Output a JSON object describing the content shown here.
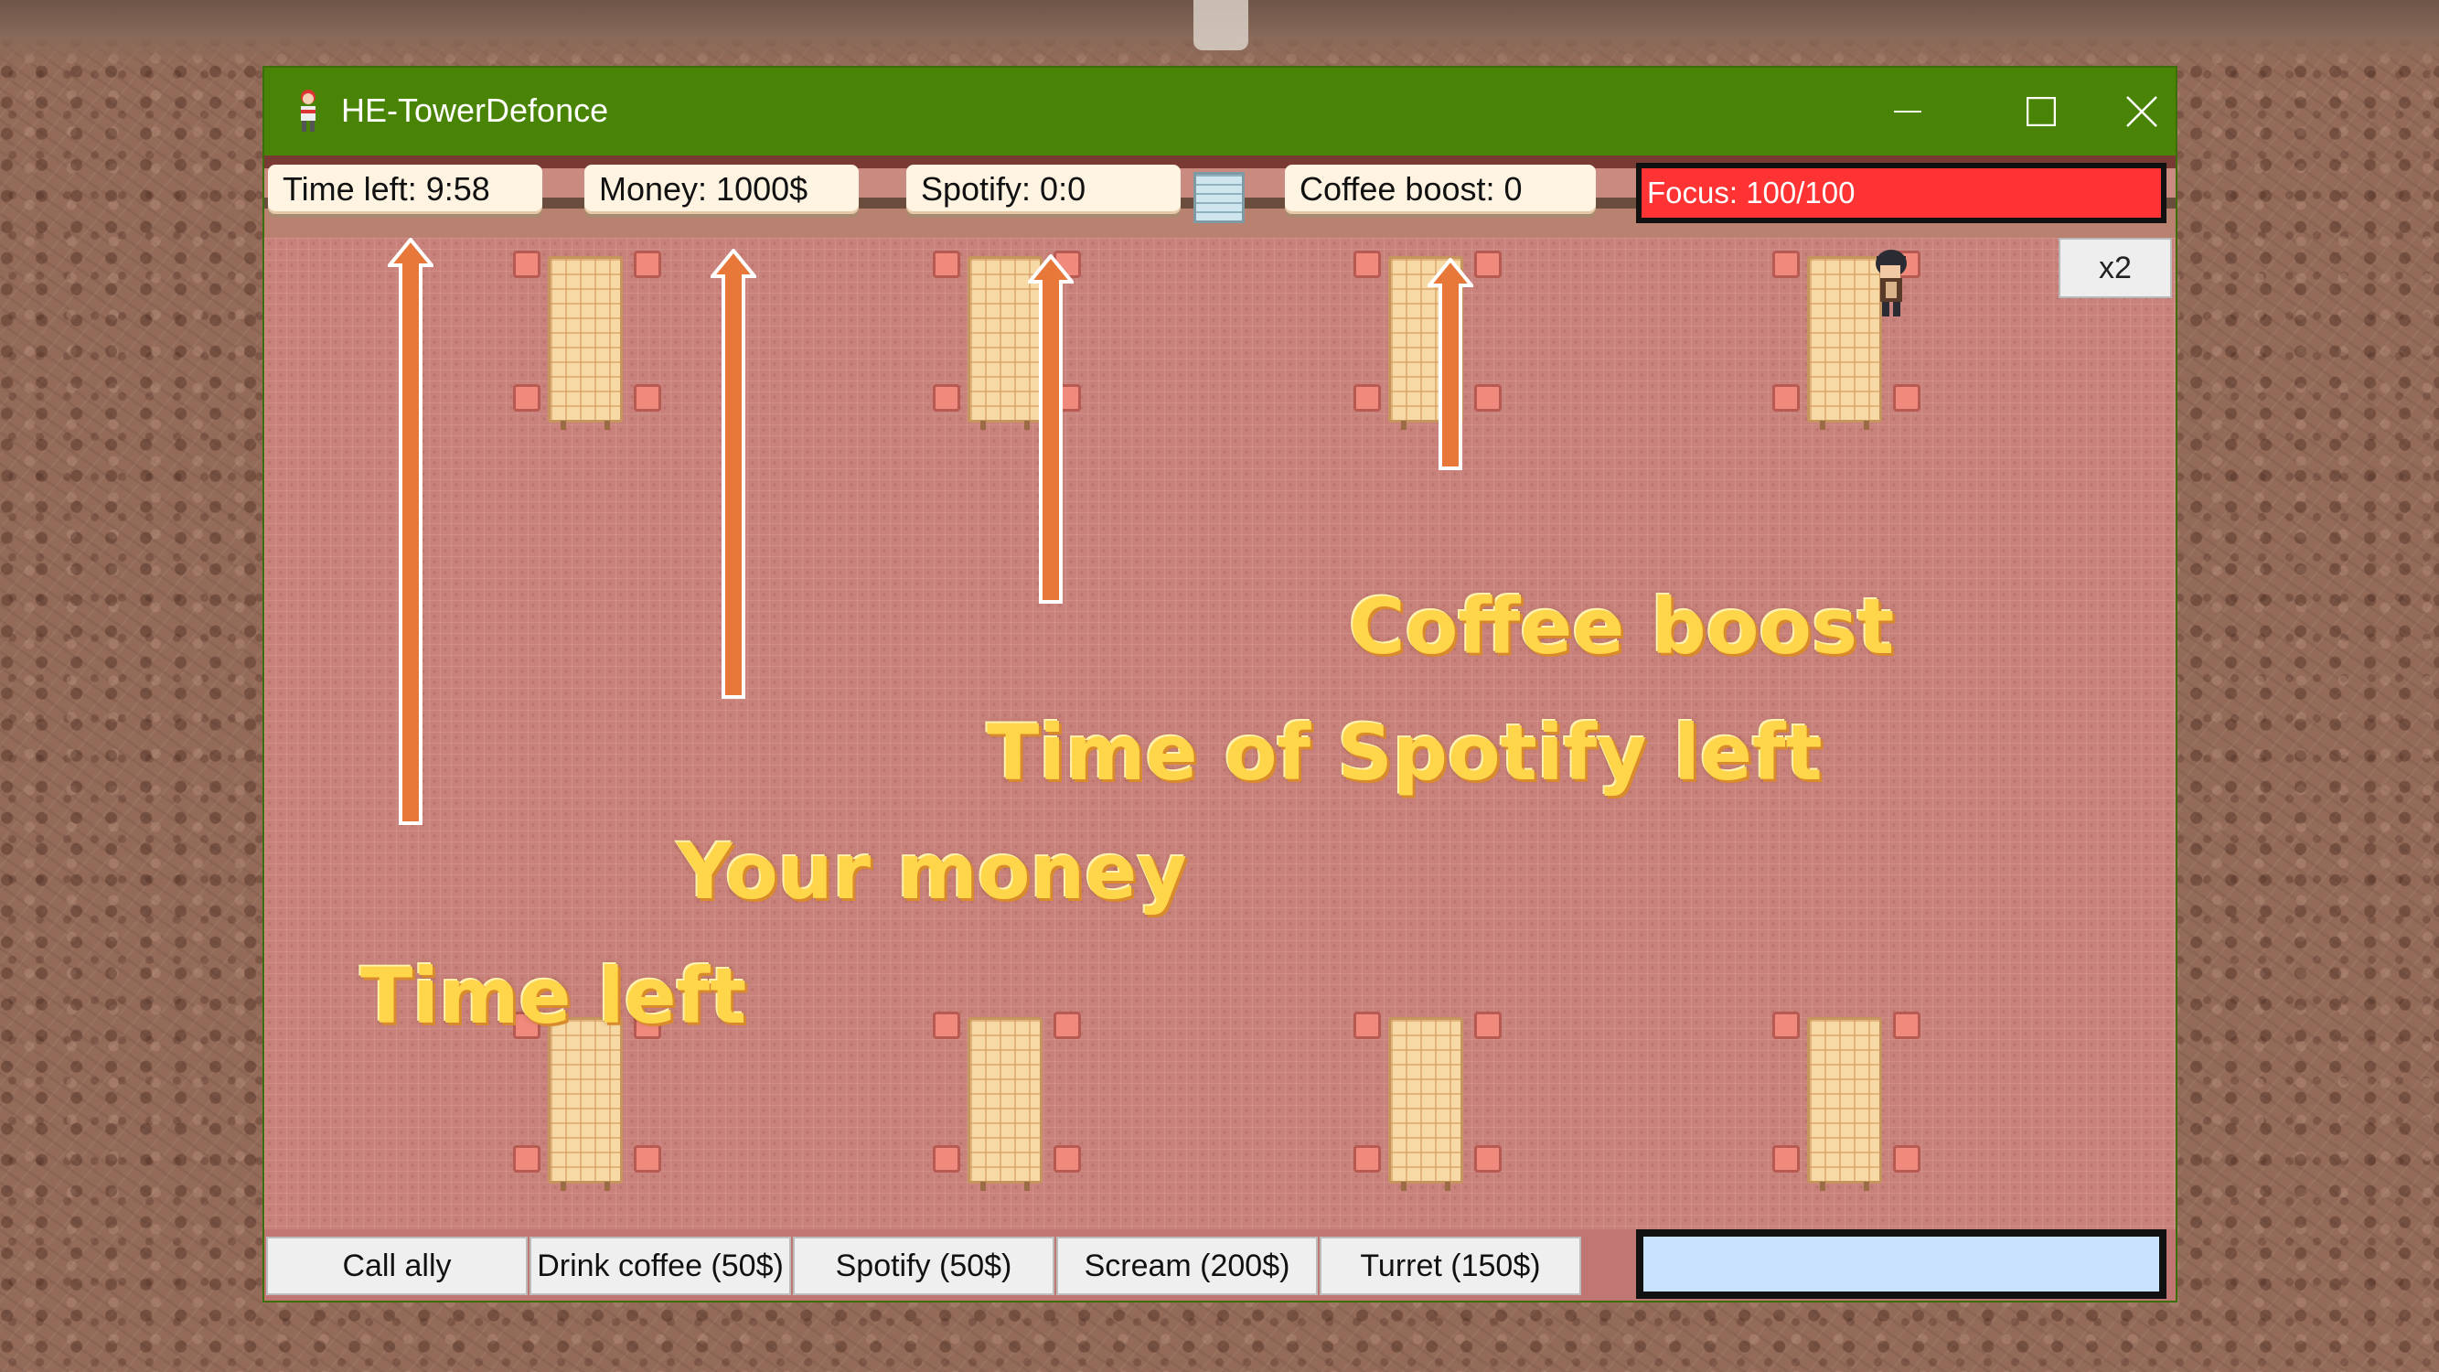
{
  "window": {
    "title": "HE-TowerDefonce",
    "title_bar_color": "#4a8406"
  },
  "icons": {
    "app": "game-app-icon",
    "minimize": "minimize-icon",
    "maximize": "maximize-icon",
    "close": "close-icon",
    "player": "player-character-icon"
  },
  "hud": {
    "time_left": "Time left: 9:58",
    "money": "Money: 1000$",
    "spotify": "Spotify: 0:0",
    "coffee_boost": "Coffee boost: 0",
    "focus_label": "Focus: ",
    "focus_value": "100/100",
    "focus_current": 100,
    "focus_max": 100,
    "focus_color": "#ff3333",
    "speed_button": "x2"
  },
  "annotations": {
    "coffee_boost": "Coffee boost",
    "spotify": "Time of Spotify left",
    "money": "Your money",
    "time_left": "Time left",
    "arrow_color": "#e8783a",
    "text_color": "#ffd54a"
  },
  "actions": [
    {
      "label": "Call ally"
    },
    {
      "label": "Drink coffee (50$)"
    },
    {
      "label": "Spotify (50$)"
    },
    {
      "label": "Scream (200$)"
    },
    {
      "label": "Turret (150$)"
    }
  ],
  "input": {
    "value": "",
    "background": "#c9e2ff"
  }
}
